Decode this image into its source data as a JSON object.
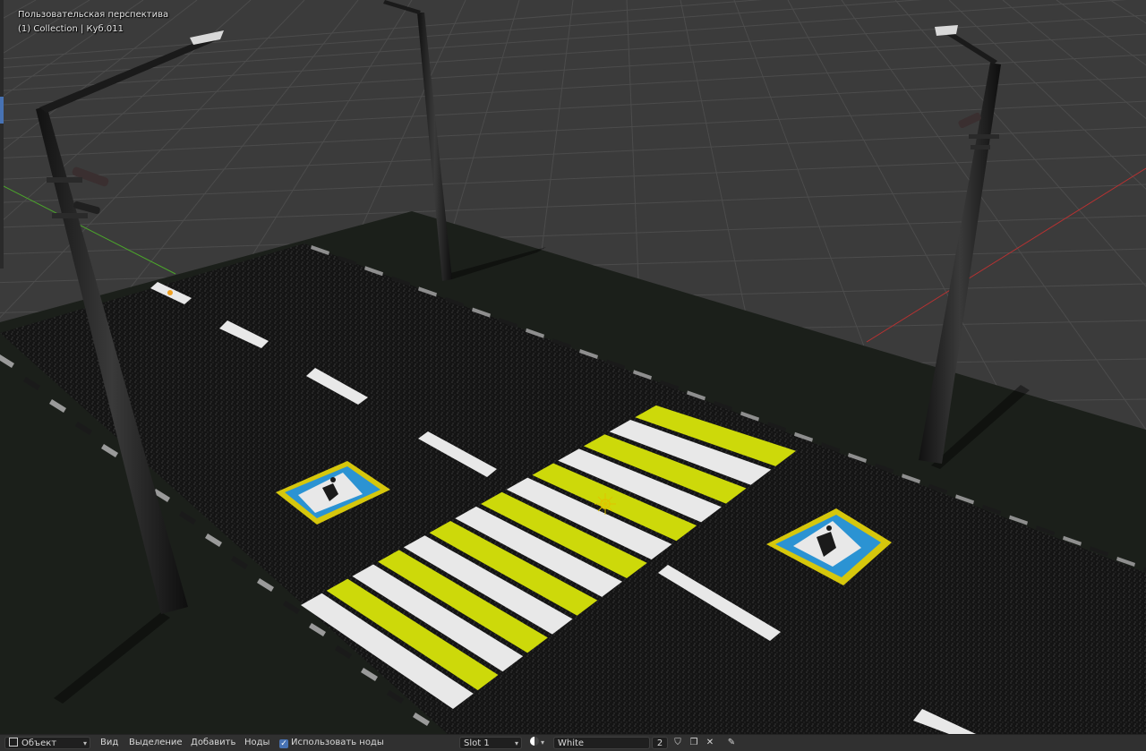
{
  "viewport": {
    "title": "Пользовательская перспектива",
    "collection": "(1) Collection | Куб.011"
  },
  "toolbar": {
    "mode": "Объект",
    "menu_view": "Вид",
    "menu_select": "Выделение",
    "menu_add": "Добавить",
    "menu_nodes": "Ноды",
    "use_nodes_label": "Использовать ноды",
    "use_nodes_checked": true,
    "slot": "Slot 1",
    "material": "White",
    "users_count": "2"
  },
  "colors": {
    "background": "#3a3a3a",
    "ground": "#1a1e19",
    "asphalt": "#131313",
    "marking_white": "#e8e8e8",
    "marking_yellow": "#cdd90a",
    "sign_blue": "#2b93d3",
    "sign_yellow": "#d6c70c",
    "axis_red": "#b83232",
    "axis_green": "#4ba52b",
    "header_bar": "#303030",
    "accent_blue": "#4772b3"
  },
  "icons": {
    "mode_icon": "object-mode-icon",
    "material_icon": "material-sphere-icon",
    "shield_icon": "fake-user-shield-icon",
    "copy_icon": "duplicate-icon",
    "close_icon": "unlink-x-icon",
    "pin_icon": "pin-icon"
  }
}
